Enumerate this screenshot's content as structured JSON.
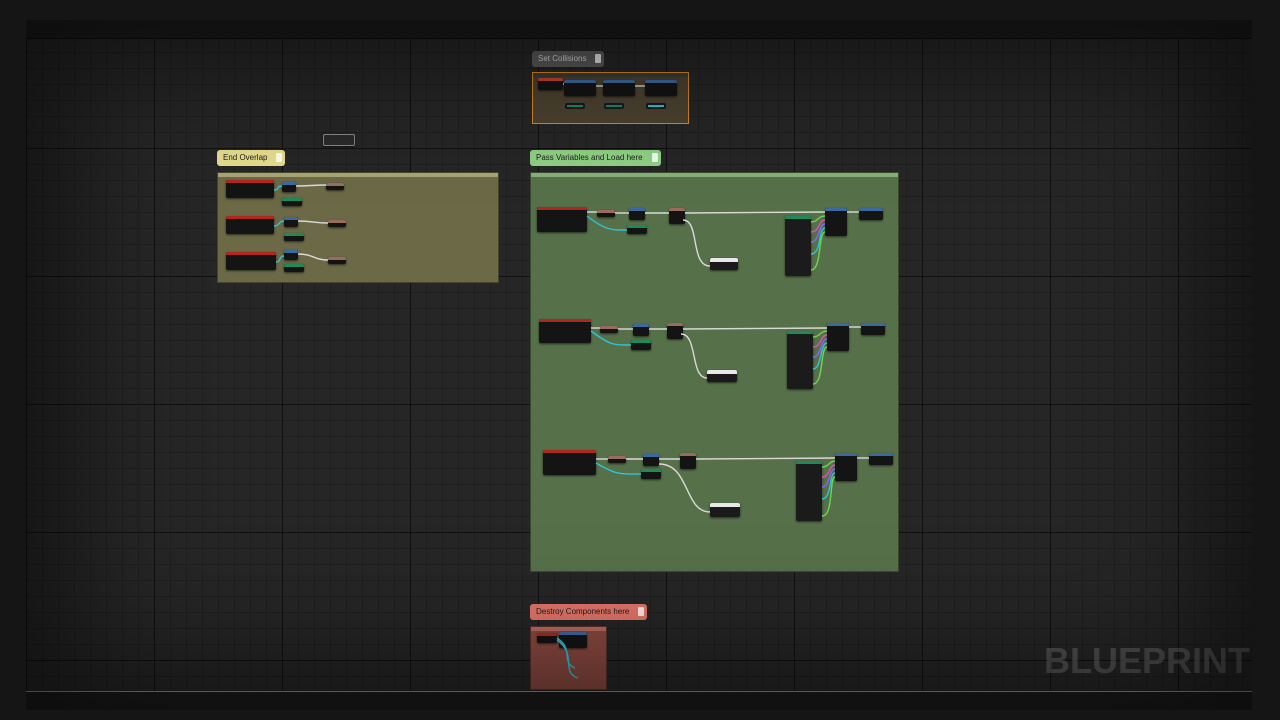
{
  "comments": {
    "set_collisions": "Set Collisions",
    "end_overlap": "End Overlap",
    "pass_variables": "Pass Variables and Load here",
    "destroy_components": "Destroy Components here"
  },
  "watermark": "BLUEPRINT",
  "colors": {
    "end_overlap_title": "#e4dc8c",
    "end_overlap_box": "#6b6946",
    "pass_variables_title": "#8fcf84",
    "pass_variables_box": "#56704a",
    "destroy_title": "#e2756a",
    "destroy_box": "#8a4a40",
    "set_collisions_title": "#5a5a5a",
    "exec_wire": "#d9d9d9",
    "object_wire": "#2ec4d6",
    "struct_wire": "#6fd64a",
    "pink_wire": "#e04fb3",
    "purple_wire": "#8a63ff"
  }
}
